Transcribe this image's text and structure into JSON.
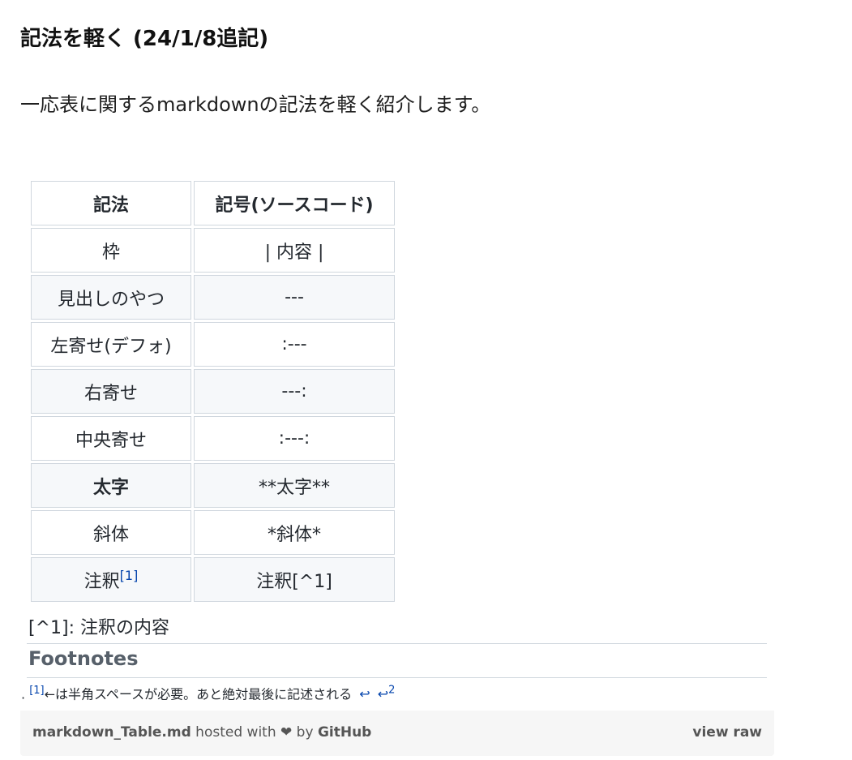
{
  "heading": "記法を軽く (24/1/8追記)",
  "intro": "一応表に関するmarkdownの記法を軽く紹介します。",
  "table": {
    "headers": [
      "記法",
      "記号(ソースコード)"
    ],
    "rows": [
      {
        "syntax": "枠",
        "code": "| 内容 |"
      },
      {
        "syntax": "見出しのやつ",
        "code": "---"
      },
      {
        "syntax": "左寄せ(デフォ)",
        "code": ":---"
      },
      {
        "syntax": "右寄せ",
        "code": "---:"
      },
      {
        "syntax": "中央寄せ",
        "code": ":---:"
      },
      {
        "syntax": "太字",
        "code": "**太字**"
      },
      {
        "syntax": "斜体",
        "code": "*斜体*"
      },
      {
        "syntax": "注釈",
        "syntax_ref": "[1]",
        "code": "注釈[^1]"
      }
    ]
  },
  "footnote_definition": "[^1]: 注釈の内容",
  "footnotes": {
    "title": "Footnotes",
    "marker": ".",
    "ref": "[1]",
    "text": "←は半角スペースが必要。あと絶対最後に記述される",
    "backref1": "↩",
    "backref2": "↩",
    "backref2_sup": "2"
  },
  "footer": {
    "filename": "markdown_Table.md",
    "hosted_with": " hosted with ",
    "heart": "❤",
    "by": " by ",
    "github": "GitHub",
    "view_raw": "view raw"
  }
}
